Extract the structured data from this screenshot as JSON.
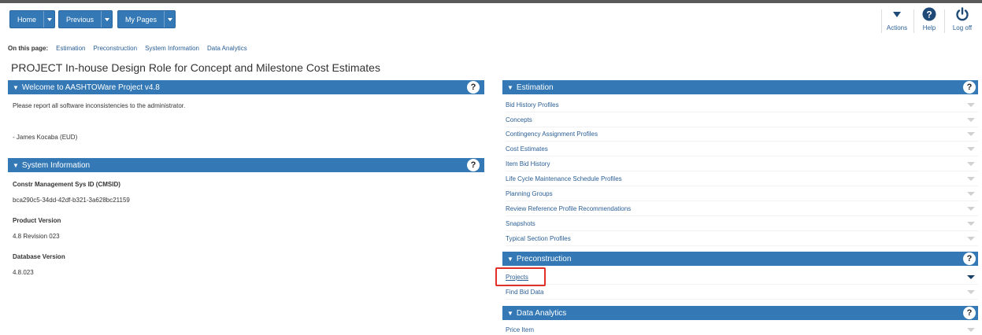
{
  "topbar": {
    "buttons": [
      {
        "label": "Home"
      },
      {
        "label": "Previous"
      },
      {
        "label": "My Pages"
      }
    ],
    "actions_label": "Actions",
    "help_label": "Help",
    "logoff_label": "Log off"
  },
  "onpage": {
    "label": "On this page:",
    "links": [
      "Estimation",
      "Preconstruction",
      "System Information",
      "Data Analytics"
    ]
  },
  "page_title": "PROJECT In-house Design Role for Concept and Milestone Cost Estimates",
  "welcome": {
    "title": "Welcome to AASHTOWare Project v4.8",
    "message": "Please report all software inconsistencies to the administrator.",
    "signature": "- James Kocaba (EUD)"
  },
  "sysinfo": {
    "title": "System Information",
    "fields": [
      {
        "label": "Constr Management Sys ID (CMSID)",
        "value": "bca290c5-34dd-42df-b321-3a628bc21159"
      },
      {
        "label": "Product Version",
        "value": "4.8 Revision 023"
      },
      {
        "label": "Database Version",
        "value": "4.8.023"
      }
    ]
  },
  "estimation": {
    "title": "Estimation",
    "items": [
      "Bid History Profiles",
      "Concepts",
      "Contingency Assignment Profiles",
      "Cost Estimates",
      "Item Bid History",
      "Life Cycle Maintenance Schedule Profiles",
      "Planning Groups",
      "Review Reference Profile Recommendations",
      "Snapshots",
      "Typical Section Profiles"
    ]
  },
  "preconstruction": {
    "title": "Preconstruction",
    "items": [
      "Projects",
      "Find Bid Data"
    ]
  },
  "analytics": {
    "title": "Data Analytics",
    "items": [
      "Price Item"
    ]
  },
  "colors": {
    "primary": "#3479b5",
    "link": "#2a5e94",
    "highlight": "#e0302a"
  }
}
